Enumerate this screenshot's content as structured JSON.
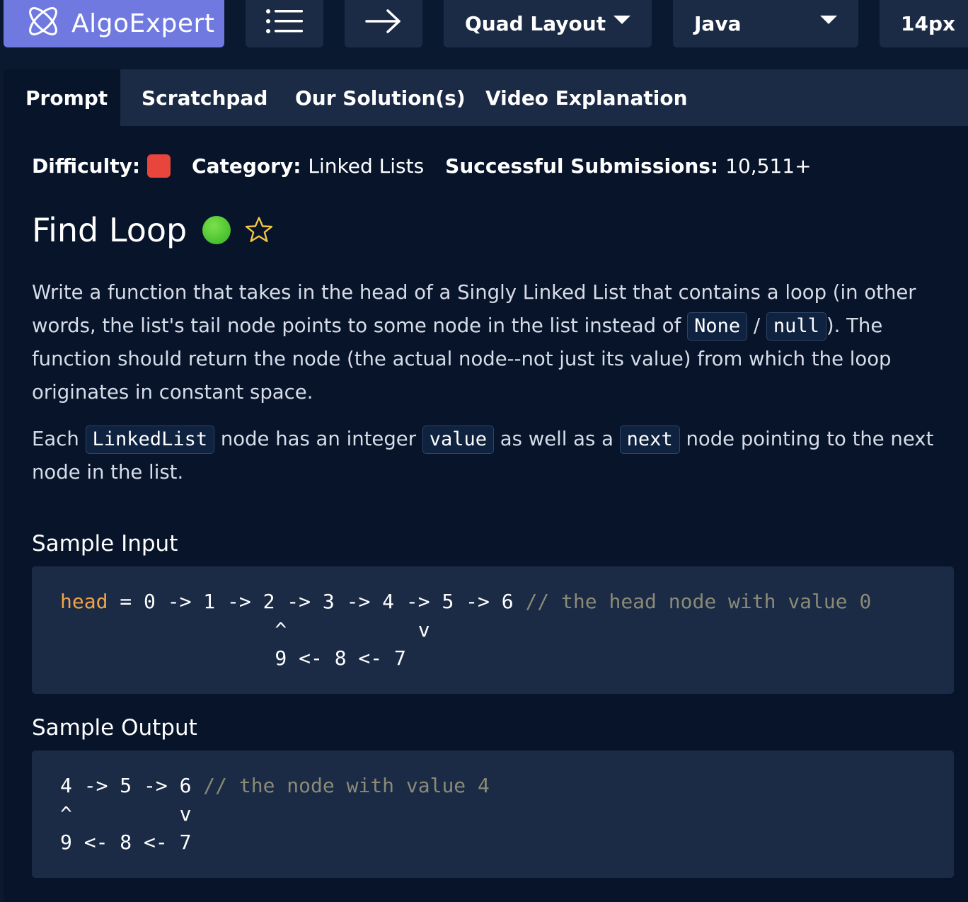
{
  "toolbar": {
    "logo_text": "AlgoExpert",
    "layout_label": "Quad Layout",
    "language_label": "Java",
    "font_size_label": "14px"
  },
  "tabs": [
    {
      "label": "Prompt",
      "active": true
    },
    {
      "label": "Scratchpad",
      "active": false
    },
    {
      "label": "Our Solution(s)",
      "active": false
    },
    {
      "label": "Video Explanation",
      "active": false
    }
  ],
  "meta": {
    "difficulty_label": "Difficulty:",
    "difficulty_color": "#e8453c",
    "category_label": "Category:",
    "category_value": "Linked Lists",
    "submissions_label": "Successful Submissions:",
    "submissions_value": "10,511+"
  },
  "question": {
    "title": "Find Loop",
    "status_color": "#4cc02e"
  },
  "prompt": {
    "p1_a": "Write a function that takes in the head of a Singly Linked List that contains a loop (in other words, the list's tail node points to some node in the list instead of ",
    "p1_code1": "None",
    "p1_sep": " / ",
    "p1_code2": "null",
    "p1_b": "). The function should return the node (the actual node--not just its value) from which the loop originates in constant space.",
    "p2_a": "Each ",
    "p2_code1": "LinkedList",
    "p2_b": " node has an integer ",
    "p2_code2": "value",
    "p2_c": " as well as a ",
    "p2_code3": "next",
    "p2_d": " node pointing to the next node in the list."
  },
  "sample_input": {
    "title": "Sample Input",
    "keyword": "head",
    "line1": " = 0 -> 1 -> 2 -> 3 -> 4 -> 5 -> 6 ",
    "comment": "// the head node with value 0",
    "line2": "                  ^           v",
    "line3": "                  9 <- 8 <- 7"
  },
  "sample_output": {
    "title": "Sample Output",
    "line1": "4 -> 5 -> 6 ",
    "comment": "// the node with value 4",
    "line2": "^         v",
    "line3": "9 <- 8 <- 7"
  }
}
